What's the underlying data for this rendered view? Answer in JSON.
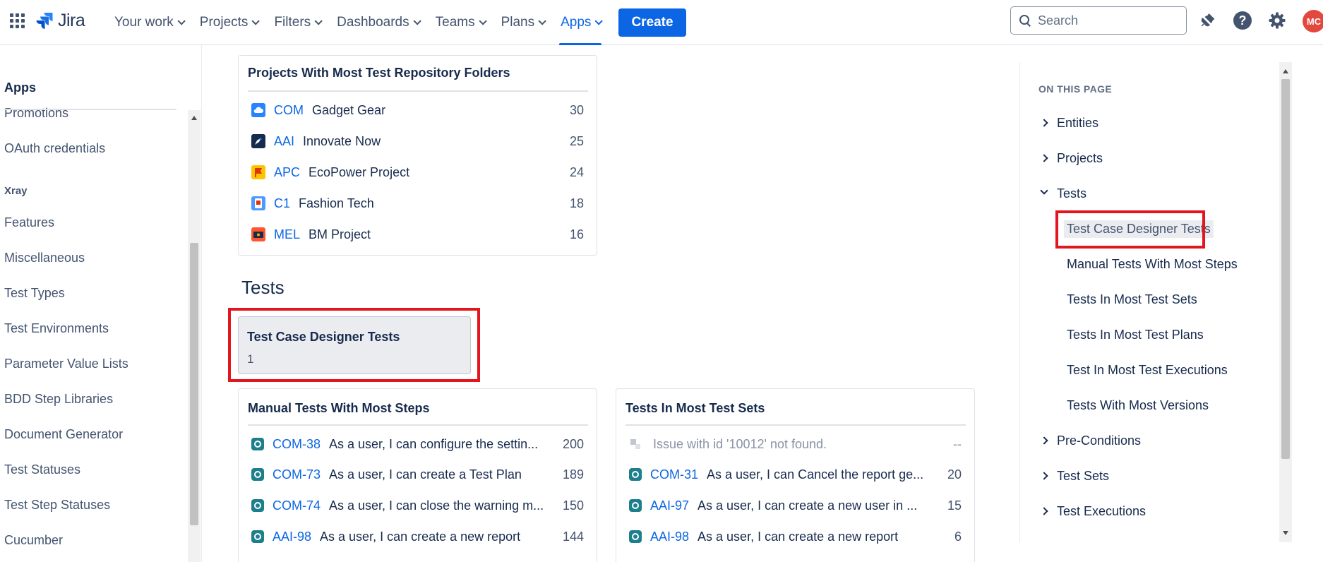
{
  "nav": {
    "logo_text": "Jira",
    "items": [
      {
        "label": "Your work"
      },
      {
        "label": "Projects"
      },
      {
        "label": "Filters"
      },
      {
        "label": "Dashboards"
      },
      {
        "label": "Teams"
      },
      {
        "label": "Plans"
      },
      {
        "label": "Apps",
        "active": true
      }
    ],
    "create_label": "Create",
    "search_placeholder": "Search",
    "help_glyph": "?",
    "avatar_initials": "MC",
    "icons": [
      "app-switcher-icon",
      "jira-logo-icon",
      "search-icon",
      "notification-bell-icon",
      "help-icon",
      "settings-gear-icon"
    ],
    "accent_color": "#0c66e4"
  },
  "sidebar": {
    "heading": "Apps",
    "items_top": [
      "Promotions",
      "OAuth credentials"
    ],
    "section_label": "Xray",
    "items": [
      "Features",
      "Miscellaneous",
      "Test Types",
      "Test Environments",
      "Parameter Value Lists",
      "BDD Step Libraries",
      "Document Generator",
      "Test Statuses",
      "Test Step Statuses",
      "Cucumber"
    ]
  },
  "folders_card": {
    "title": "Projects With Most Test Repository Folders",
    "rows": [
      {
        "key": "COM",
        "name": "Gadget Gear",
        "count": "30",
        "icon": "cloud-project-icon"
      },
      {
        "key": "AAI",
        "name": "Innovate Now",
        "count": "25",
        "icon": "rocket-project-icon"
      },
      {
        "key": "APC",
        "name": "EcoPower Project",
        "count": "24",
        "icon": "flag-project-icon"
      },
      {
        "key": "C1",
        "name": "Fashion Tech",
        "count": "18",
        "icon": "device-project-icon"
      },
      {
        "key": "MEL",
        "name": "BM Project",
        "count": "16",
        "icon": "money-project-icon"
      }
    ]
  },
  "tests_section": {
    "heading": "Tests",
    "metric_title": "Test Case Designer Tests",
    "metric_value": "1"
  },
  "manual_steps_card": {
    "title": "Manual Tests With Most Steps",
    "rows": [
      {
        "key": "COM-38",
        "name": "As a user, I can configure the settin...",
        "count": "200"
      },
      {
        "key": "COM-73",
        "name": "As a user, I can create a Test Plan",
        "count": "189"
      },
      {
        "key": "COM-74",
        "name": "As a user, I can close the warning m...",
        "count": "150"
      },
      {
        "key": "AAI-98",
        "name": "As a user, I can create a new report",
        "count": "144"
      }
    ]
  },
  "test_sets_card": {
    "title": "Tests In Most Test Sets",
    "missing_row": {
      "text": "Issue with id '10012' not found.",
      "count": "--"
    },
    "rows": [
      {
        "key": "COM-31",
        "name": "As a user, I can Cancel the report ge...",
        "count": "20"
      },
      {
        "key": "AAI-97",
        "name": "As a user, I can create a new user in ...",
        "count": "15"
      },
      {
        "key": "AAI-98",
        "name": "As a user, I can create a new report",
        "count": "6"
      }
    ]
  },
  "toc": {
    "heading": "ON THIS PAGE",
    "items": [
      {
        "label": "Entities",
        "expanded": false
      },
      {
        "label": "Projects",
        "expanded": false
      },
      {
        "label": "Tests",
        "expanded": true
      }
    ],
    "sub_items": [
      "Test Case Designer Tests",
      "Manual Tests With Most Steps",
      "Tests In Most Test Sets",
      "Tests In Most Test Plans",
      "Test In Most Test Executions",
      "Tests With Most Versions"
    ],
    "items_after": [
      "Pre-Conditions",
      "Test Sets",
      "Test Executions"
    ]
  },
  "highlight_color": "#e3161f"
}
